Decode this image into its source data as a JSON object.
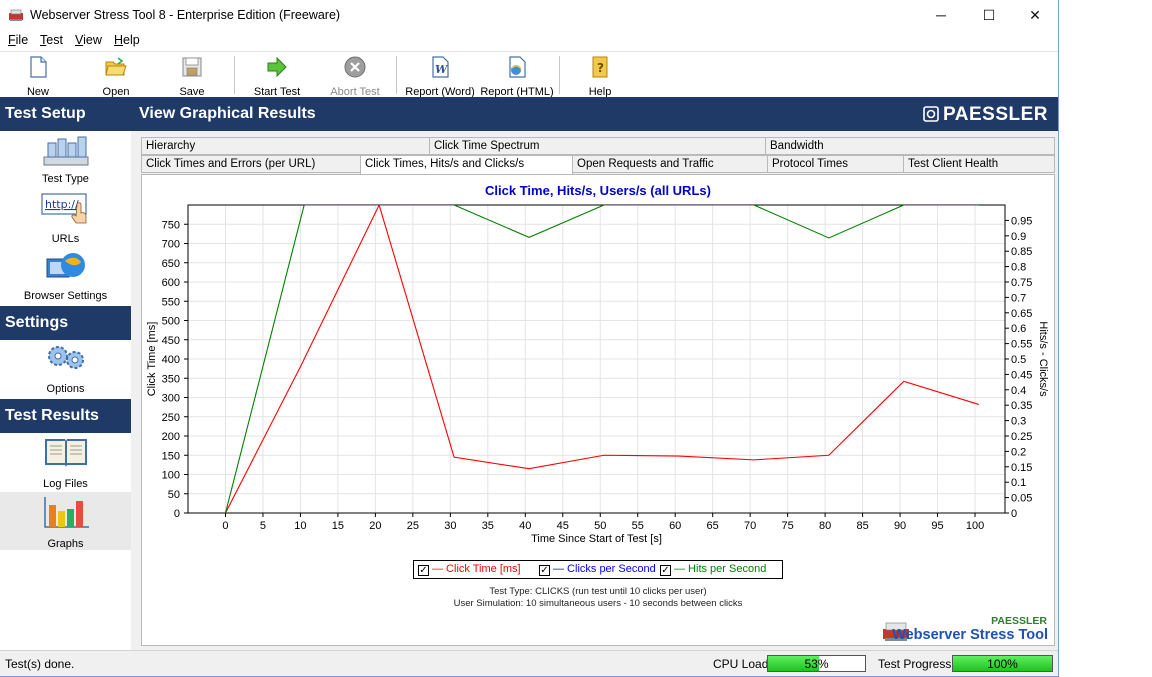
{
  "window": {
    "title": "Webserver Stress Tool 8 - Enterprise Edition (Freeware)",
    "minimize": "─",
    "maximize": "☐",
    "close": "✕"
  },
  "menu": [
    {
      "label": "File",
      "accel": "F",
      "rest": "ile"
    },
    {
      "label": "Test",
      "accel": "T",
      "rest": "est"
    },
    {
      "label": "View",
      "accel": "V",
      "rest": "iew"
    },
    {
      "label": "Help",
      "accel": "H",
      "rest": "elp"
    }
  ],
  "toolbar": {
    "new": "New",
    "open": "Open",
    "save": "Save",
    "start_test": "Start Test",
    "abort_test": "Abort Test",
    "report_word": "Report (Word)",
    "report_html": "Report (HTML)",
    "help": "Help"
  },
  "sidebar": {
    "test_setup": "Test Setup",
    "test_type": "Test Type",
    "urls": "URLs",
    "browser_settings": "Browser Settings",
    "settings": "Settings",
    "options": "Options",
    "test_results": "Test Results",
    "log_files": "Log Files",
    "graphs": "Graphs",
    "url_icon_text": "http://"
  },
  "main": {
    "title": "View Graphical Results",
    "brand": "PAESSLER"
  },
  "tabs": {
    "row1": [
      "Hierarchy",
      "Click Time Spectrum",
      "Bandwidth"
    ],
    "row2": [
      "Click Times and Errors (per URL)",
      "Click Times, Hits/s and Clicks/s",
      "Open Requests and Traffic",
      "Protocol Times",
      "Test Client Health"
    ],
    "active": "Click Times, Hits/s and Clicks/s"
  },
  "chart_data": {
    "type": "line",
    "title": "Click Time, Hits/s, Users/s (all URLs)",
    "xlabel": "Time Since Start of Test [s]",
    "ylabel": "Click Time [ms]",
    "y2label": "Hits/s - Clicks/s",
    "xlim": [
      -5,
      104
    ],
    "ylim": [
      0,
      800
    ],
    "y2lim": [
      0,
      1.0
    ],
    "xticks": [
      0,
      5,
      10,
      15,
      20,
      25,
      30,
      35,
      40,
      45,
      50,
      55,
      60,
      65,
      70,
      75,
      80,
      85,
      90,
      95,
      100
    ],
    "yticks": [
      0,
      50,
      100,
      150,
      200,
      250,
      300,
      350,
      400,
      450,
      500,
      550,
      600,
      650,
      700,
      750
    ],
    "y2ticks": [
      "0",
      "0.05",
      "0.1",
      "0.15",
      "0.2",
      "0.25",
      "0.3",
      "0.35",
      "0.4",
      "0.45",
      "0.5",
      "0.55",
      "0.6",
      "0.65",
      "0.7",
      "0.75",
      "0.8",
      "0.85",
      "0.9",
      "0.95"
    ],
    "grid": true,
    "series": [
      {
        "name": "Click Time [ms]",
        "axis": "left",
        "color": "#ff0000",
        "x": [
          0,
          10,
          20.5,
          30.5,
          40.5,
          50.5,
          60.5,
          70.5,
          80.5,
          90.5,
          100.5
        ],
        "y": [
          0,
          380,
          800,
          145,
          115,
          150,
          148,
          138,
          150,
          342,
          282
        ]
      },
      {
        "name": "Clicks per Second",
        "axis": "right",
        "color": "#0000ff",
        "x": [],
        "y": []
      },
      {
        "name": "Hits per Second",
        "axis": "right",
        "color": "#008000",
        "x": [
          0,
          10.5,
          30.5,
          40.5,
          50.5,
          70.5,
          80.5,
          90.5,
          100.5
        ],
        "y": [
          0,
          1.0,
          1.0,
          0.895,
          1.0,
          1.0,
          0.893,
          1.0,
          1.0
        ]
      }
    ]
  },
  "legend": {
    "click_time": "— Click Time [ms]",
    "clicks_per_second": "— Clicks per Second",
    "hits_per_second": "— Hits per Second",
    "check": "✓"
  },
  "info": {
    "line1": "Test Type: CLICKS (run test until 10 clicks per user)",
    "line2": "User Simulation: 10 simultaneous users - 10 seconds between clicks"
  },
  "branding": {
    "small": "PAESSLER",
    "product": "Webserver Stress Tool"
  },
  "status": {
    "message": "Test(s) done.",
    "cpu_label": "CPU Load:",
    "cpu_value": "53%",
    "cpu_fraction": 0.53,
    "progress_label": "Test Progress:",
    "progress_value": "100%",
    "progress_fraction": 1.0
  },
  "colors": {
    "header_bg": "#1f3a67",
    "title_blue": "#0000cc",
    "progress_green": "#22cc22"
  }
}
